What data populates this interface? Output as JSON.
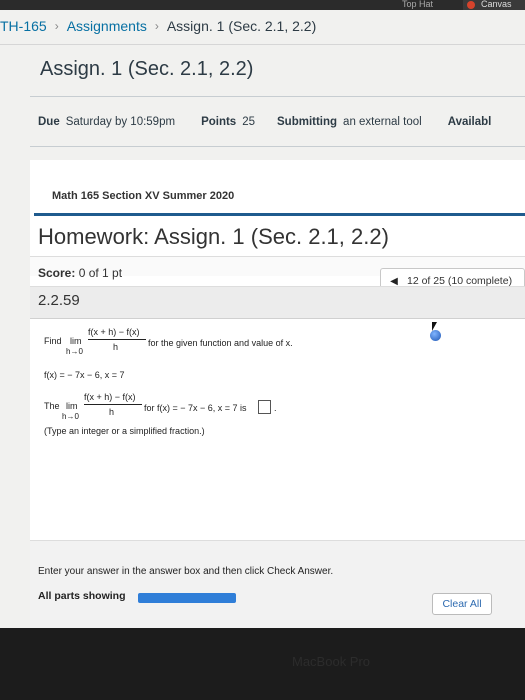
{
  "browser": {
    "tab_partial": "Top Hat",
    "canvas_tab": "Canvas"
  },
  "breadcrumb": {
    "course": "TH-165",
    "section": "Assignments",
    "current": "Assign. 1 (Sec. 2.1, 2.2)"
  },
  "assignment": {
    "title": "Assign. 1 (Sec. 2.1, 2.2)",
    "due_label": "Due",
    "due_value": "Saturday by 10:59pm",
    "points_label": "Points",
    "points_value": "25",
    "submitting_label": "Submitting",
    "submitting_value": "an external tool",
    "available_label": "Availabl"
  },
  "homework": {
    "course_name": "Math 165 Section XV Summer 2020",
    "title": "Homework: Assign. 1 (Sec. 2.1, 2.2)",
    "score_label": "Score:",
    "score_value": "0 of 1 pt",
    "progress_text": "12 of 25 (10 complete)",
    "question_id": "2.2.59"
  },
  "question": {
    "find": "Find",
    "lim": "lim",
    "numerator": "f(x + h) − f(x)",
    "denominator": "h",
    "limit_sub": "h→0",
    "instruction_tail": "for the given function and value of x.",
    "function_line": "f(x) = − 7x − 6, x = 7",
    "the": "The",
    "answer_tail": "for f(x) = − 7x − 6, x = 7 is",
    "answer_end": ".",
    "hint": "(Type an integer or a simplified fraction.)"
  },
  "footer": {
    "instruction": "Enter your answer in the answer box and then click Check Answer.",
    "all_parts": "All parts showing",
    "clear_all": "Clear All"
  },
  "device": {
    "label": "MacBook Pro"
  },
  "colors": {
    "link": "#0770a3",
    "accent_line": "#1f5b8e",
    "progress": "#2f7ed8"
  }
}
